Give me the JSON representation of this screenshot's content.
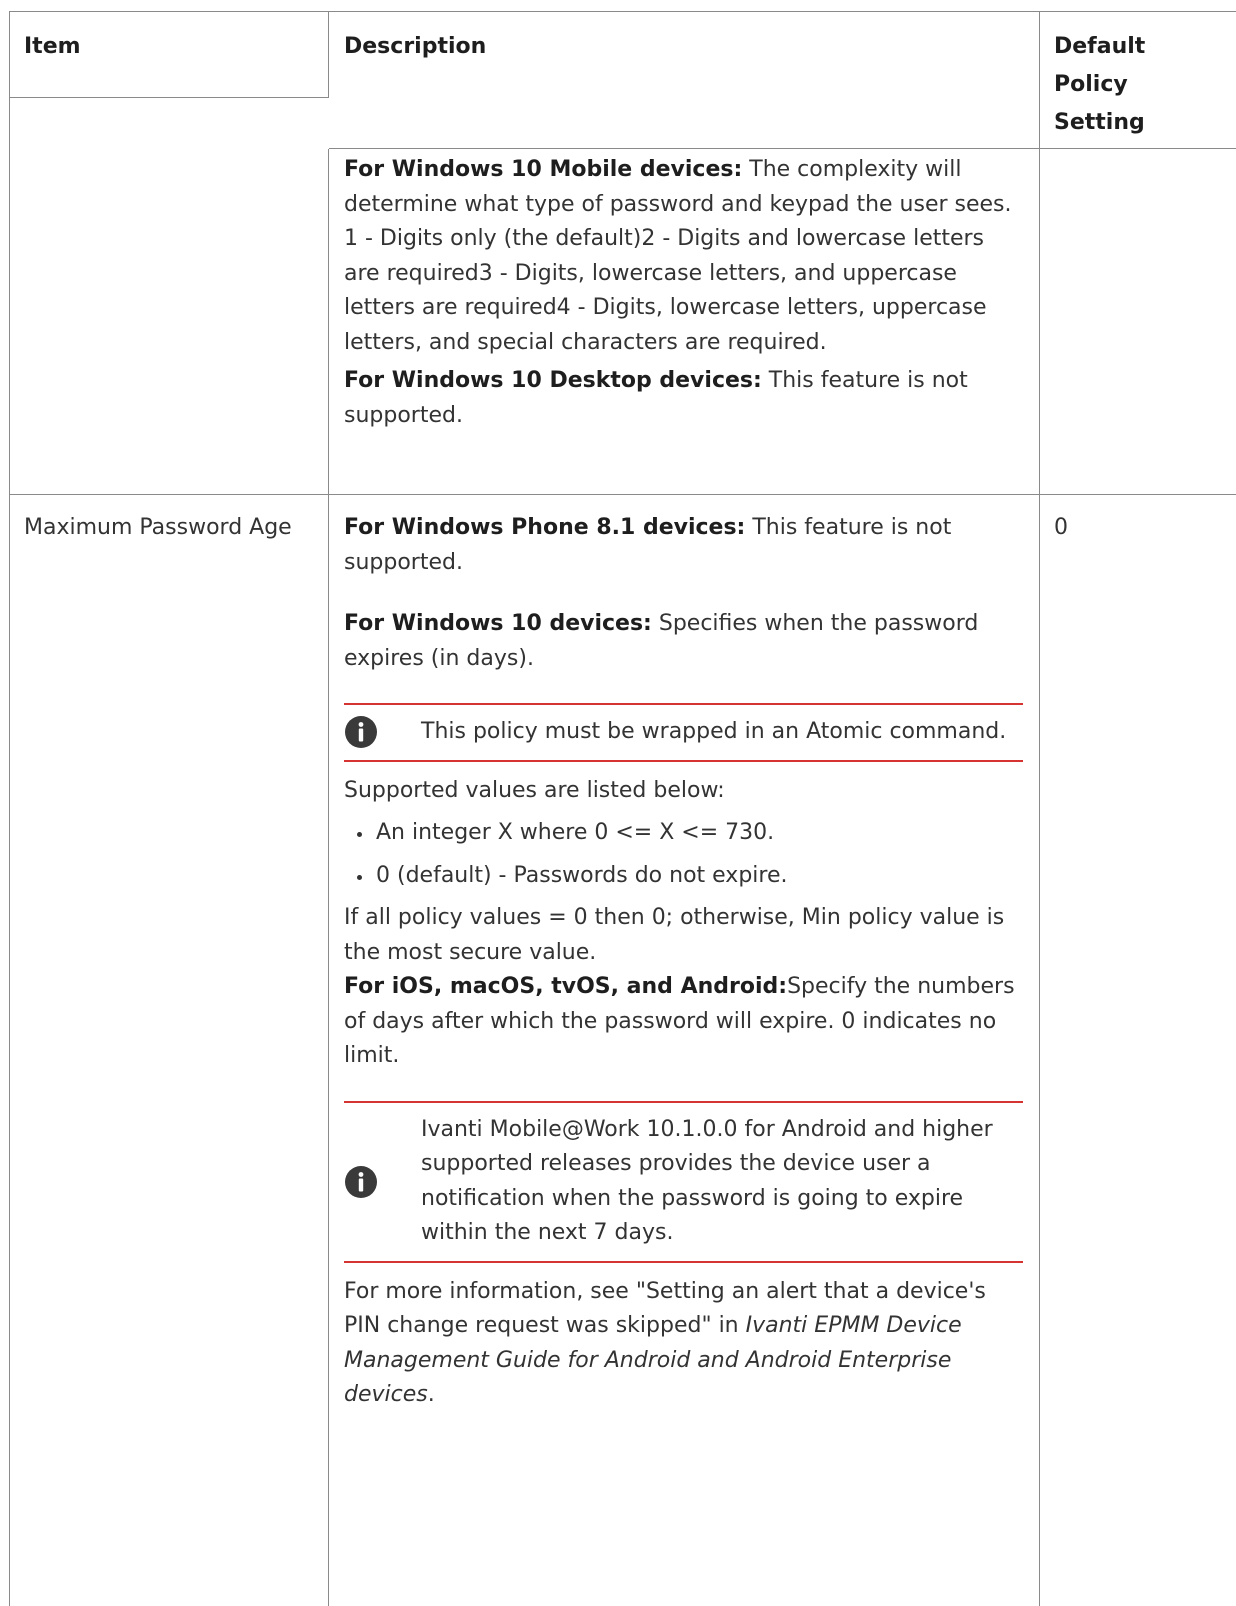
{
  "header": {
    "item": "Item",
    "description": "Description",
    "default": "Default Policy Setting"
  },
  "row1": {
    "mobile_label": "For Windows 10 Mobile devices:",
    "mobile_text": " The complexity will determine what type of password and keypad the user sees. 1 - Digits only (the default)2 - Digits and lowercase letters are required3 - Digits, lowercase letters, and uppercase letters are required4 - Digits, lowercase letters, uppercase letters, and special characters are required.",
    "desktop_label": "For Windows 10 Desktop devices:",
    "desktop_text": " This feature is not supported."
  },
  "row2": {
    "item": "Maximum Password Age",
    "default": "0",
    "wp81_label": "For Windows Phone 8.1 devices:",
    "wp81_text": " This feature is not supported.",
    "w10_label": "For Windows 10 devices:",
    "w10_text": " Specifies when the password expires (in days).",
    "note1": "This policy must be wrapped in an Atomic command.",
    "supported_intro": "Supported values are listed below:",
    "bullets": [
      "An integer X where 0 <= X <= 730.",
      "0 (default) - Passwords do not expire."
    ],
    "policy_text": "If all policy values = 0 then 0; otherwise, Min policy value is the most secure value.",
    "ios_label": "For iOS, macOS, tvOS, and Android:",
    "ios_text": "Specify the numbers of days after which the password will expire. 0 indicates no limit.",
    "note2": "Ivanti Mobile@Work 10.1.0.0 for Android and higher supported releases provides the device user a notification when the password is going to expire within the next 7 days.",
    "more_prefix": "For more information, see \"Setting an alert that a device's PIN change request was skipped\" in ",
    "more_ref": "Ivanti EPMM Device Management Guide for Android and Android Enterprise devices",
    "more_suffix": "."
  },
  "icons": {
    "note": "info-icon"
  },
  "colors": {
    "note_rule": "#d63333",
    "icon_fill": "#3a3a3a",
    "border": "#8a8a8a"
  }
}
